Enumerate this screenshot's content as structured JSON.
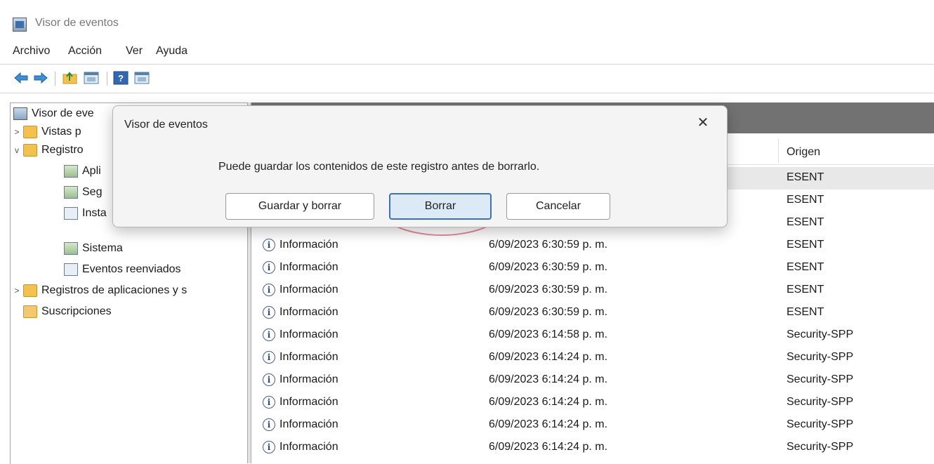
{
  "window": {
    "title": "Visor de eventos"
  },
  "menu": [
    "Archivo",
    "Acción",
    "Ver",
    "Ayuda"
  ],
  "toolbar": {
    "icons": [
      "back-arrow-icon",
      "forward-arrow-icon",
      "folder-up-icon",
      "properties-pane-icon",
      "help-icon",
      "show-pane-icon"
    ]
  },
  "tree": {
    "root": "Visor de eve",
    "items": [
      {
        "label": "Vistas p",
        "expander": ">"
      },
      {
        "label": "Registro",
        "expander": "v"
      },
      {
        "label": "Apli"
      },
      {
        "label": "Seg"
      },
      {
        "label": "Insta"
      },
      {
        "label": "Sistema"
      },
      {
        "label": "Eventos reenviados"
      },
      {
        "label": "Registros de aplicaciones y s",
        "expander": ">"
      },
      {
        "label": "Suscripciones"
      }
    ]
  },
  "list": {
    "columns": {
      "origin": "Origen"
    },
    "rows": [
      {
        "level": "",
        "date": "",
        "origin": "ESENT"
      },
      {
        "level": "",
        "date": "",
        "origin": "ESENT"
      },
      {
        "level": "",
        "date": "",
        "origin": "ESENT"
      },
      {
        "level": "Información",
        "date": "6/09/2023 6:30:59 p. m.",
        "origin": "ESENT"
      },
      {
        "level": "Información",
        "date": "6/09/2023 6:30:59 p. m.",
        "origin": "ESENT"
      },
      {
        "level": "Información",
        "date": "6/09/2023 6:30:59 p. m.",
        "origin": "ESENT"
      },
      {
        "level": "Información",
        "date": "6/09/2023 6:30:59 p. m.",
        "origin": "ESENT"
      },
      {
        "level": "Información",
        "date": "6/09/2023 6:14:58 p. m.",
        "origin": "Security-SPP"
      },
      {
        "level": "Información",
        "date": "6/09/2023 6:14:24 p. m.",
        "origin": "Security-SPP"
      },
      {
        "level": "Información",
        "date": "6/09/2023 6:14:24 p. m.",
        "origin": "Security-SPP"
      },
      {
        "level": "Información",
        "date": "6/09/2023 6:14:24 p. m.",
        "origin": "Security-SPP"
      },
      {
        "level": "Información",
        "date": "6/09/2023 6:14:24 p. m.",
        "origin": "Security-SPP"
      },
      {
        "level": "Información",
        "date": "6/09/2023 6:14:24 p. m.",
        "origin": "Security-SPP"
      }
    ]
  },
  "dialog": {
    "title": "Visor de eventos",
    "message": "Puede guardar los contenidos de este registro antes de borrarlo.",
    "buttons": {
      "save_clear": "Guardar y borrar",
      "clear": "Borrar",
      "cancel": "Cancelar"
    },
    "close_glyph": "✕"
  }
}
